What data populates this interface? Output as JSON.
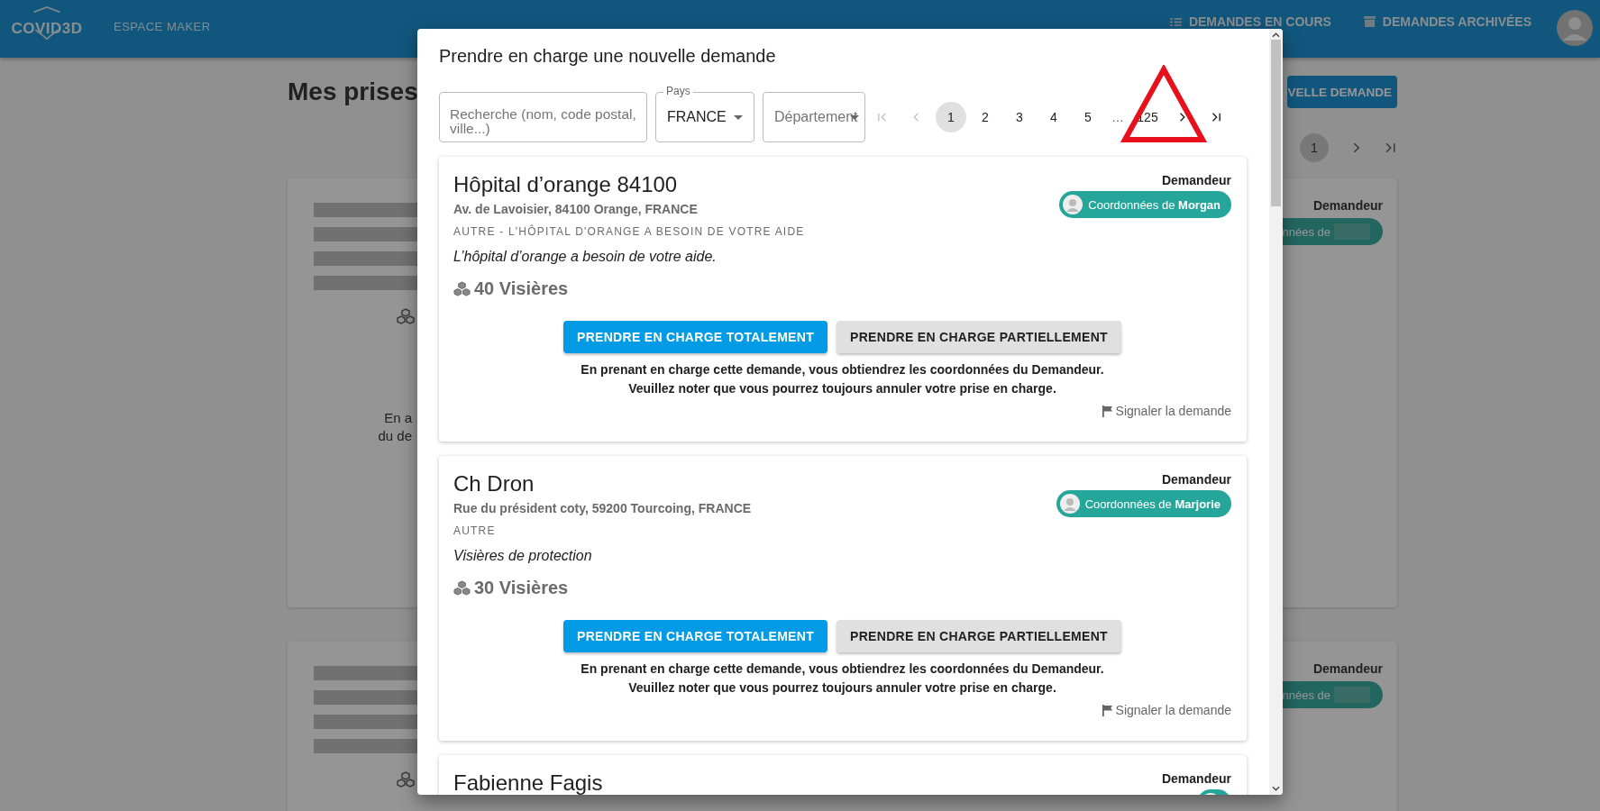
{
  "header": {
    "logo": "COVID3D",
    "section": "ESPACE MAKER",
    "nav": [
      {
        "kind": "list",
        "label": "DEMANDES EN COURS"
      },
      {
        "kind": "archive",
        "label": "DEMANDES ARCHIVÉES"
      }
    ]
  },
  "page": {
    "title": "Mes prises",
    "new_button": "VELLE DEMANDE",
    "pages": [
      {
        "label": "1",
        "selected": true
      }
    ],
    "cards": [
      {
        "requester_label": "Demandeur",
        "chip_text": "nnées de",
        "lines": [
          "En a",
          "du de"
        ]
      },
      {
        "requester_label": "Demandeur",
        "chip_text": "nnées de"
      }
    ]
  },
  "dialog": {
    "title": "Prendre en charge une nouvelle demande",
    "search": {
      "placeholder": "Recherche (nom, code postal, ville...)"
    },
    "country": {
      "label": "Pays",
      "value": "FRANCE"
    },
    "department": {
      "placeholder": "Département"
    },
    "page_nav": [
      {
        "kind": "first",
        "disabled": true
      },
      {
        "kind": "prev",
        "disabled": true
      },
      {
        "kind": "next",
        "disabled": false
      },
      {
        "kind": "last",
        "disabled": false
      }
    ],
    "pages": [
      {
        "kind": "page",
        "label": "1",
        "selected": true
      },
      {
        "kind": "page",
        "label": "2",
        "selected": false
      },
      {
        "kind": "page",
        "label": "3",
        "selected": false
      },
      {
        "kind": "page",
        "label": "4",
        "selected": false
      },
      {
        "kind": "page",
        "label": "5",
        "selected": false
      },
      {
        "kind": "ellipsis",
        "label": "…",
        "selected": false
      },
      {
        "kind": "page",
        "label": "125",
        "selected": false
      }
    ],
    "requests": [
      {
        "title": "Hôpital d’orange 84100",
        "address": "Av. de Lavoisier, 84100 Orange, FRANCE",
        "category": "AUTRE - L'HÔPITAL D'ORANGE A BESOIN DE VOTRE AIDE",
        "description": "L’hôpital d’orange a besoin de votre aide.",
        "quantity": "40 Visières",
        "requester_label": "Demandeur",
        "contact": "Coordonnées de **Morgan**",
        "primary_button": "PRENDRE EN CHARGE TOTALEMENT",
        "secondary_button": "PRENDRE EN CHARGE PARTIELLEMENT",
        "notice": [
          "En prenant en charge cette demande, vous obtiendrez les coordonnées du Demandeur.",
          "Veuillez noter que vous pourrez toujours annuler votre prise en charge."
        ],
        "report": "Signaler la demande"
      },
      {
        "title": "Ch Dron",
        "address": "Rue du président coty, 59200 Tourcoing, FRANCE",
        "category": "AUTRE",
        "description": "Visières de protection",
        "quantity": "30 Visières",
        "requester_label": "Demandeur",
        "contact": "Coordonnées de **Marjorie**",
        "primary_button": "PRENDRE EN CHARGE TOTALEMENT",
        "secondary_button": "PRENDRE EN CHARGE PARTIELLEMENT",
        "notice": [
          "En prenant en charge cette demande, vous obtiendrez les coordonnées du Demandeur.",
          "Veuillez noter que vous pourrez toujours annuler votre prise en charge."
        ],
        "report": "Signaler la demande"
      },
      {
        "title": "Fabienne Fagis",
        "requester_label": "Demandeur"
      }
    ]
  }
}
